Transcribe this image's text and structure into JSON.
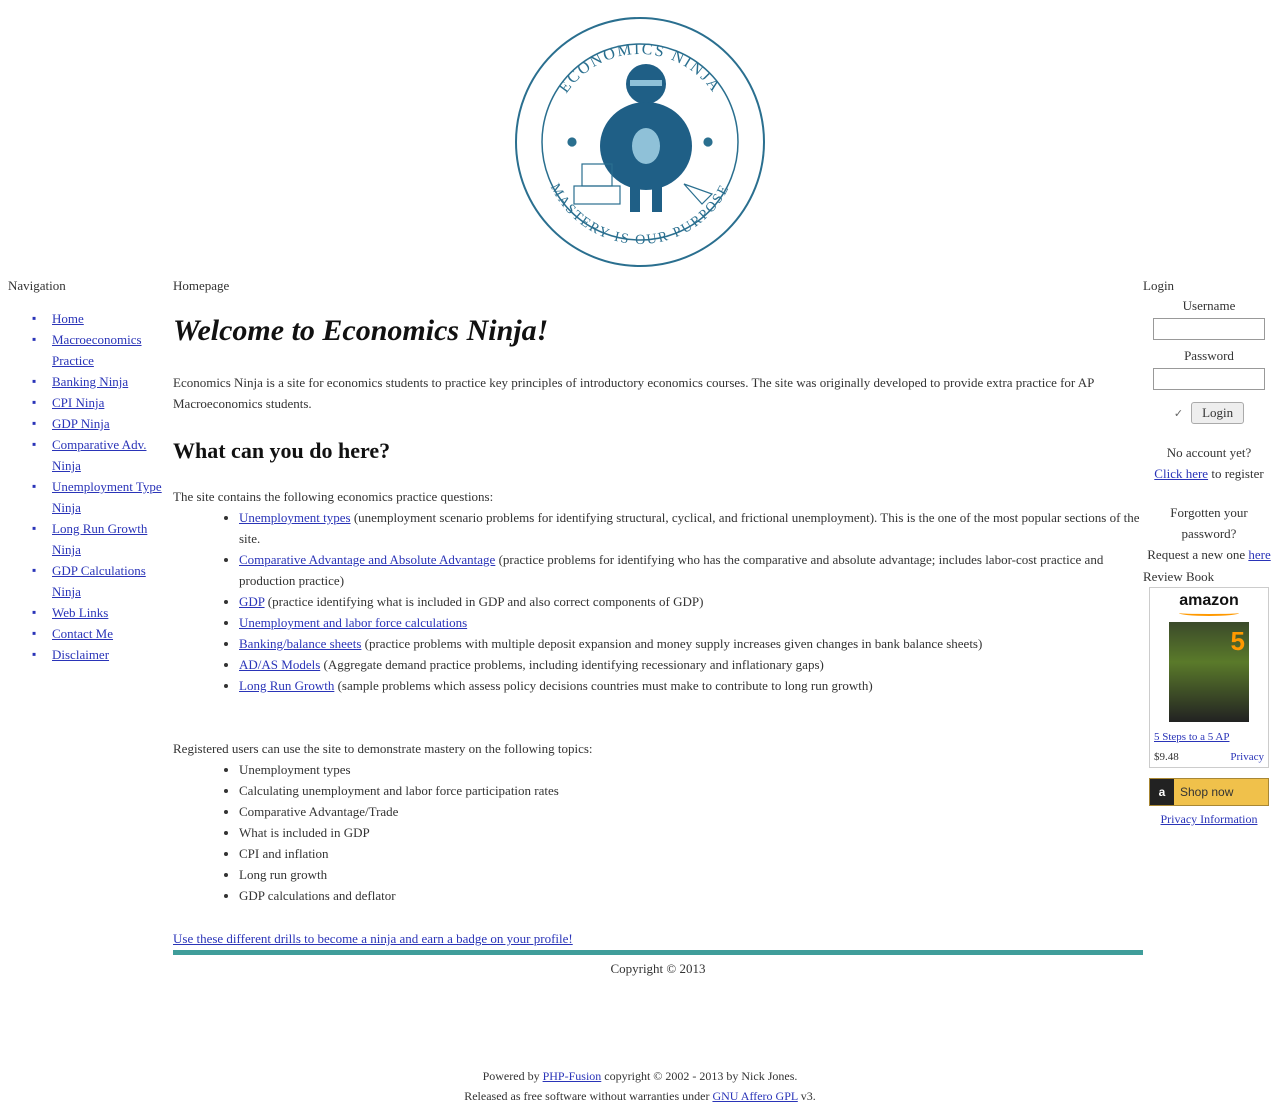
{
  "header": {
    "logo_top_text": "ECONOMICS NINJA",
    "logo_bottom_text": "MASTERY IS OUR PURPOSE"
  },
  "nav": {
    "title": "Navigation",
    "items": [
      {
        "label": "Home"
      },
      {
        "label": "Macroeconomics Practice"
      },
      {
        "label": "Banking Ninja"
      },
      {
        "label": "CPI Ninja"
      },
      {
        "label": "GDP Ninja"
      },
      {
        "label": "Comparative Adv. Ninja"
      },
      {
        "label": "Unemployment Type Ninja"
      },
      {
        "label": "Long Run Growth Ninja"
      },
      {
        "label": "GDP Calculations Ninja"
      },
      {
        "label": "Web Links"
      },
      {
        "label": "Contact Me"
      },
      {
        "label": "Disclaimer"
      }
    ]
  },
  "main": {
    "breadcrumb": "Homepage",
    "title": "Welcome to Economics Ninja!",
    "intro": "Economics Ninja is a site for economics students to practice key principles of introductory economics courses. The site was originally developed to provide extra practice for AP Macroeconomics students.",
    "subheading": "What can you do here?",
    "practice_intro": "The site contains the following economics practice questions:",
    "practice_items": [
      {
        "link": "Unemployment types",
        "desc": "(unemployment scenario problems for identifying structural, cyclical, and frictional unemployment). This is the one of the most popular sections of the site."
      },
      {
        "link": "Comparative Advantage and Absolute Advantage",
        "desc": "(practice problems for identifying who has the comparative and absolute advantage; includes labor-cost practice and production practice)"
      },
      {
        "link": "GDP",
        "desc": "(practice identifying what is included in GDP and also correct components of GDP)"
      },
      {
        "link": "Unemployment and labor force calculations",
        "desc": ""
      },
      {
        "link": "Banking/balance sheets",
        "desc": "(practice problems with multiple deposit expansion and money supply increases given changes in bank balance sheets)"
      },
      {
        "link": "AD/AS Models",
        "desc": "(Aggregate demand practice problems, including identifying recessionary and inflationary gaps)"
      },
      {
        "link": "Long Run Growth",
        "desc": "(sample problems which assess policy decisions countries must make to contribute to long run growth)"
      }
    ],
    "registered_intro": "Registered users can use the site to demonstrate mastery on the following topics:",
    "registered_items": [
      "Unemployment types",
      "Calculating unemployment and labor force participation rates",
      "Comparative Advantage/Trade",
      "What is included in GDP",
      "CPI and inflation",
      "Long run growth",
      "GDP calculations and deflator"
    ],
    "ninja_link": "Use these different drills to become a ninja and earn a badge on your profile!",
    "copyright": "Copyright © 2013"
  },
  "login": {
    "title": "Login",
    "username_label": "Username",
    "password_label": "Password",
    "remember_symbol": "✓",
    "login_button": "Login",
    "no_account_text": "No account yet?",
    "click_here": "Click here",
    "register_suffix": "to register",
    "forgot_text": "Forgotten your password?",
    "request_text": "Request a new one",
    "request_link": "here",
    "review_title": "Review Book",
    "amazon_logo": "amazon",
    "book_title": "5 Steps to a 5 AP",
    "book_price": "$9.48",
    "book_info": "Privacy",
    "shop_label": "Shop now",
    "privacy_link": "Privacy Information"
  },
  "footer": {
    "line1_prefix": "Powered by",
    "line1_link": "PHP-Fusion",
    "line1_suffix": "copyright © 2002 - 2013 by Nick Jones.",
    "line2_prefix": "Released as free software without warranties under",
    "line2_link": "GNU Affero GPL",
    "line2_suffix": "v3."
  },
  "colors": {
    "link": "#2a34b8",
    "accent_bar": "#3f9d9a",
    "logo_blue": "#1f5f86"
  }
}
